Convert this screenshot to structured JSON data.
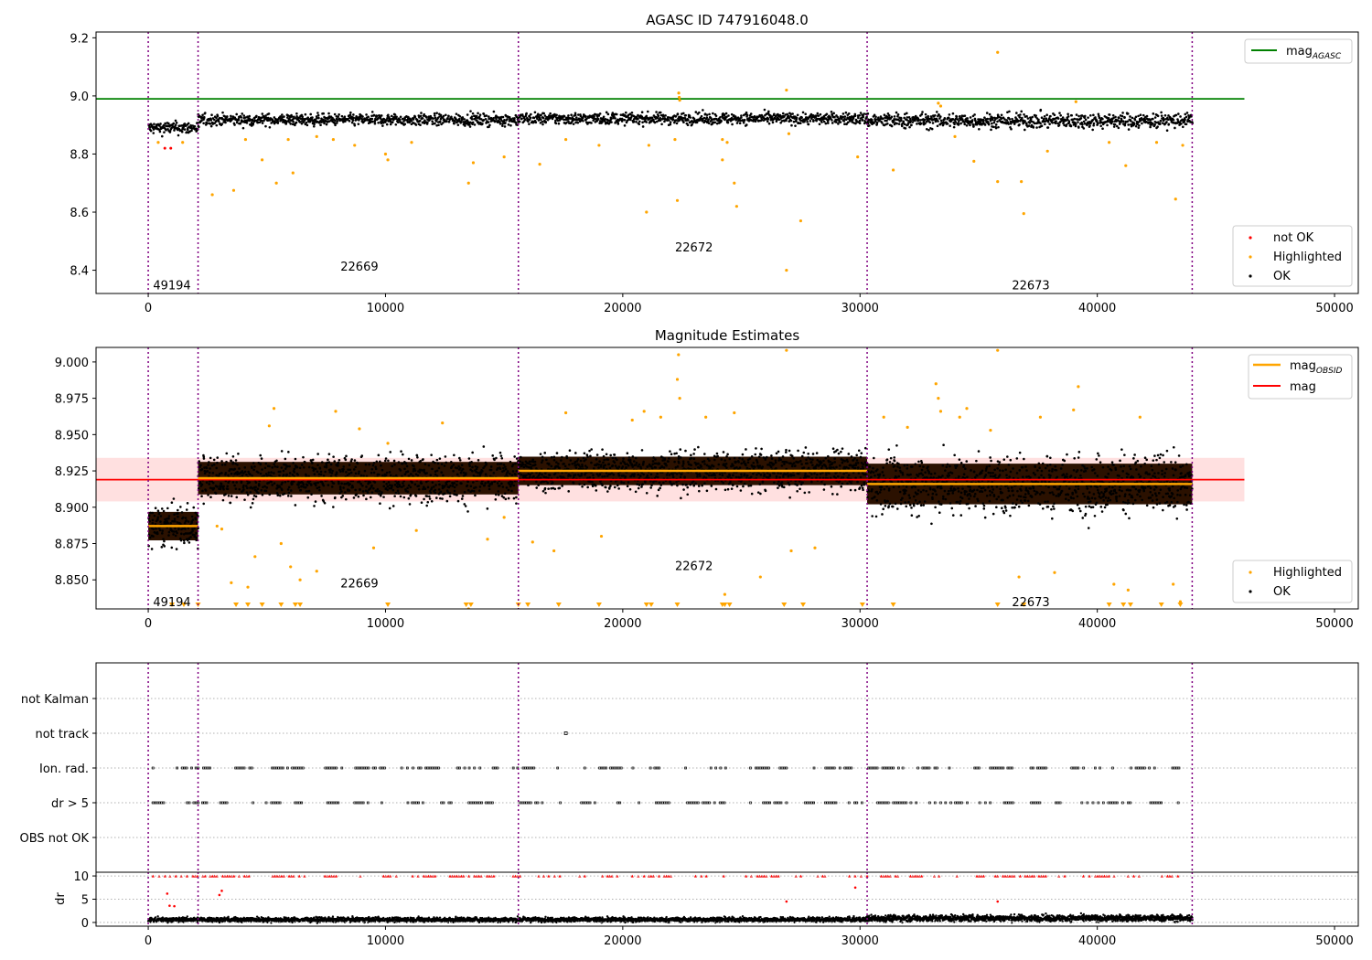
{
  "chart_data": [
    {
      "type": "scatter",
      "title": "AGASC ID 747916048.0",
      "xlim": [
        -2200,
        51000
      ],
      "ylim": [
        8.32,
        9.22
      ],
      "xticks": [
        0,
        10000,
        20000,
        30000,
        40000,
        50000
      ],
      "xtick_labels": [
        "0",
        "10000",
        "20000",
        "30000",
        "40000",
        "50000"
      ],
      "yticks": [
        8.4,
        8.6,
        8.8,
        9.0,
        9.2
      ],
      "ytick_labels": [
        "8.4",
        "8.6",
        "8.8",
        "9.0",
        "9.2"
      ],
      "obsid_boundaries": [
        0,
        2100,
        15600,
        30300,
        44000
      ],
      "obsid_labels": [
        {
          "text": "49194",
          "x": 1000,
          "y": 8.35
        },
        {
          "text": "22669",
          "x": 8900,
          "y": 8.415
        },
        {
          "text": "22672",
          "x": 23000,
          "y": 8.48
        },
        {
          "text": "22673",
          "x": 37200,
          "y": 8.35
        }
      ],
      "hline": {
        "name": "mag_AGASC",
        "y": 8.99,
        "x_range": [
          -2200,
          46200
        ],
        "color": "#008000"
      },
      "ok_band_segments": [
        {
          "x": [
            0,
            2100
          ],
          "center": 8.89,
          "spread": 0.022
        },
        {
          "x": [
            2100,
            15600
          ],
          "center": 8.918,
          "spread": 0.02
        },
        {
          "x": [
            15600,
            30300
          ],
          "center": 8.922,
          "spread": 0.02
        },
        {
          "x": [
            30300,
            44000
          ],
          "center": 8.915,
          "spread": 0.026
        }
      ],
      "highlighted_points": [
        [
          420,
          8.84
        ],
        [
          1450,
          8.84
        ],
        [
          2700,
          8.66
        ],
        [
          3600,
          8.675
        ],
        [
          4100,
          8.85
        ],
        [
          4800,
          8.78
        ],
        [
          5400,
          8.7
        ],
        [
          5900,
          8.85
        ],
        [
          6100,
          8.735
        ],
        [
          7100,
          8.86
        ],
        [
          7800,
          8.85
        ],
        [
          8700,
          8.83
        ],
        [
          10000,
          8.8
        ],
        [
          10100,
          8.78
        ],
        [
          11100,
          8.84
        ],
        [
          13500,
          8.7
        ],
        [
          13700,
          8.77
        ],
        [
          15000,
          8.79
        ],
        [
          16500,
          8.765
        ],
        [
          17600,
          8.85
        ],
        [
          19000,
          8.83
        ],
        [
          21000,
          8.6
        ],
        [
          21100,
          8.83
        ],
        [
          22200,
          8.85
        ],
        [
          22300,
          8.64
        ],
        [
          22360,
          9.01
        ],
        [
          22380,
          8.995
        ],
        [
          22400,
          8.985
        ],
        [
          24200,
          8.78
        ],
        [
          24200,
          8.85
        ],
        [
          24400,
          8.84
        ],
        [
          24700,
          8.7
        ],
        [
          24800,
          8.62
        ],
        [
          26900,
          8.4
        ],
        [
          26900,
          9.02
        ],
        [
          27000,
          8.87
        ],
        [
          27500,
          8.57
        ],
        [
          29900,
          8.79
        ],
        [
          31400,
          8.745
        ],
        [
          33300,
          8.975
        ],
        [
          33400,
          8.965
        ],
        [
          34000,
          8.86
        ],
        [
          34800,
          8.775
        ],
        [
          35800,
          8.705
        ],
        [
          35800,
          9.15
        ],
        [
          36800,
          8.705
        ],
        [
          36900,
          8.595
        ],
        [
          37900,
          8.81
        ],
        [
          39100,
          8.98
        ],
        [
          40500,
          8.84
        ],
        [
          41200,
          8.76
        ],
        [
          42500,
          8.84
        ],
        [
          43300,
          8.645
        ],
        [
          43600,
          8.83
        ]
      ],
      "notok_points": [
        [
          700,
          8.82
        ],
        [
          950,
          8.82
        ]
      ],
      "legends": [
        {
          "position": "top-right",
          "entries": [
            {
              "label": "mag",
              "sub": "AGASC",
              "kind": "line",
              "color": "#008000"
            }
          ]
        },
        {
          "position": "bottom-right",
          "entries": [
            {
              "label": "not OK",
              "kind": "dot",
              "color": "#ff0000"
            },
            {
              "label": "Highlighted",
              "kind": "dot",
              "color": "#ffa500"
            },
            {
              "label": "OK",
              "kind": "dot",
              "color": "#000000"
            }
          ]
        }
      ]
    },
    {
      "type": "scatter",
      "title": "Magnitude Estimates",
      "xlim": [
        -2200,
        51000
      ],
      "ylim": [
        8.83,
        9.01
      ],
      "xticks": [
        0,
        10000,
        20000,
        30000,
        40000,
        50000
      ],
      "xtick_labels": [
        "0",
        "10000",
        "20000",
        "30000",
        "40000",
        "50000"
      ],
      "yticks": [
        8.85,
        8.875,
        8.9,
        8.925,
        8.95,
        8.975,
        9.0
      ],
      "ytick_labels": [
        "8.850",
        "8.875",
        "8.900",
        "8.925",
        "8.950",
        "8.975",
        "9.000"
      ],
      "obsid_boundaries": [
        0,
        2100,
        15600,
        30300,
        44000
      ],
      "obsid_labels": [
        {
          "text": "49194",
          "x": 1000,
          "y": 8.835
        },
        {
          "text": "22669",
          "x": 8900,
          "y": 8.848
        },
        {
          "text": "22672",
          "x": 23000,
          "y": 8.86
        },
        {
          "text": "22673",
          "x": 37200,
          "y": 8.835
        }
      ],
      "mag": {
        "name": "mag",
        "y": 8.919,
        "band": [
          8.904,
          8.934
        ],
        "x_range": [
          -2200,
          46200
        ],
        "color": "#ff0000"
      },
      "mag_obsid": [
        {
          "x": [
            0,
            2100
          ],
          "y": 8.887
        },
        {
          "x": [
            2100,
            15600
          ],
          "y": 8.92
        },
        {
          "x": [
            15600,
            30300
          ],
          "y": 8.925
        },
        {
          "x": [
            30300,
            44000
          ],
          "y": 8.916
        }
      ],
      "ok_band_segments": [
        {
          "x": [
            0,
            2100
          ],
          "center": 8.887,
          "spread": 0.014
        },
        {
          "x": [
            2100,
            15600
          ],
          "center": 8.92,
          "spread": 0.016
        },
        {
          "x": [
            15600,
            30300
          ],
          "center": 8.925,
          "spread": 0.014
        },
        {
          "x": [
            30300,
            44000
          ],
          "center": 8.916,
          "spread": 0.02
        }
      ],
      "highlighted_points": [
        [
          2900,
          8.887
        ],
        [
          3100,
          8.885
        ],
        [
          3500,
          8.848
        ],
        [
          4200,
          8.845
        ],
        [
          4500,
          8.866
        ],
        [
          5100,
          8.956
        ],
        [
          5300,
          8.968
        ],
        [
          5600,
          8.875
        ],
        [
          6000,
          8.859
        ],
        [
          6400,
          8.85
        ],
        [
          7100,
          8.856
        ],
        [
          7900,
          8.966
        ],
        [
          8900,
          8.954
        ],
        [
          9500,
          8.872
        ],
        [
          10100,
          8.944
        ],
        [
          11300,
          8.884
        ],
        [
          12400,
          8.958
        ],
        [
          13500,
          8.83
        ],
        [
          14300,
          8.878
        ],
        [
          15000,
          8.893
        ],
        [
          16200,
          8.876
        ],
        [
          17100,
          8.87
        ],
        [
          17600,
          8.965
        ],
        [
          19100,
          8.88
        ],
        [
          20400,
          8.96
        ],
        [
          20900,
          8.966
        ],
        [
          21600,
          8.962
        ],
        [
          22300,
          8.988
        ],
        [
          22350,
          9.005
        ],
        [
          22400,
          8.975
        ],
        [
          23500,
          8.962
        ],
        [
          24300,
          8.84
        ],
        [
          24700,
          8.965
        ],
        [
          25800,
          8.852
        ],
        [
          26900,
          9.008
        ],
        [
          27100,
          8.87
        ],
        [
          28100,
          8.872
        ],
        [
          31000,
          8.962
        ],
        [
          32000,
          8.955
        ],
        [
          33200,
          8.985
        ],
        [
          33300,
          8.975
        ],
        [
          33400,
          8.966
        ],
        [
          34200,
          8.962
        ],
        [
          34500,
          8.968
        ],
        [
          35500,
          8.953
        ],
        [
          35800,
          9.008
        ],
        [
          36700,
          8.852
        ],
        [
          37600,
          8.962
        ],
        [
          38200,
          8.855
        ],
        [
          39200,
          8.983
        ],
        [
          39000,
          8.967
        ],
        [
          40700,
          8.847
        ],
        [
          41300,
          8.843
        ],
        [
          41800,
          8.962
        ],
        [
          43200,
          8.847
        ],
        [
          43500,
          8.835
        ]
      ],
      "clipped_x": [
        1000,
        1500,
        2100,
        3700,
        4200,
        4800,
        5600,
        6200,
        6400,
        10100,
        13400,
        13600,
        15600,
        16000,
        17300,
        19000,
        21000,
        21200,
        22300,
        24200,
        24300,
        24500,
        26800,
        27600,
        30100,
        31400,
        35800,
        36900,
        40500,
        41100,
        41400,
        42700,
        43500
      ],
      "legends": [
        {
          "position": "top-right",
          "entries": [
            {
              "label": "mag",
              "sub": "OBSID",
              "kind": "line",
              "color": "#ffa500"
            },
            {
              "label": "mag",
              "kind": "line",
              "color": "#ff0000"
            }
          ]
        },
        {
          "position": "bottom-right",
          "entries": [
            {
              "label": "Highlighted",
              "kind": "dot",
              "color": "#ffa500"
            },
            {
              "label": "OK",
              "kind": "dot",
              "color": "#000000"
            }
          ]
        }
      ]
    },
    {
      "type": "scatter",
      "xlim": [
        -2200,
        51000
      ],
      "categories": [
        "not Kalman",
        "not track",
        "Ion. rad.",
        "dr > 5",
        "OBS not OK"
      ],
      "obsid_boundaries": [
        0,
        2100,
        15600,
        30300,
        44000
      ],
      "flag_points": {
        "not track": [
          17600
        ],
        "Ion. rad.": "frequent",
        "dr > 5": "frequent"
      }
    },
    {
      "type": "scatter",
      "ylabel": "dr",
      "xlim": [
        -2200,
        51000
      ],
      "ylim": [
        -0.8,
        10.8
      ],
      "xticks": [
        0,
        10000,
        20000,
        30000,
        40000,
        50000
      ],
      "xtick_labels": [
        "0",
        "10000",
        "20000",
        "30000",
        "40000",
        "50000"
      ],
      "yticks": [
        0,
        5,
        10
      ],
      "ytick_labels": [
        "0",
        "5",
        "10"
      ],
      "obsid_boundaries": [
        0,
        2100,
        15600,
        30300,
        44000
      ],
      "red_points": [
        [
          800,
          6.2
        ],
        [
          900,
          3.6
        ],
        [
          1100,
          3.5
        ],
        [
          3000,
          5.9
        ],
        [
          3100,
          6.8
        ],
        [
          26900,
          4.5
        ],
        [
          29800,
          7.5
        ],
        [
          35800,
          4.5
        ]
      ],
      "ok_band_segments": [
        {
          "x": [
            0,
            30300
          ],
          "center": 0.6,
          "spread": 0.5
        },
        {
          "x": [
            30300,
            44000
          ],
          "center": 0.9,
          "spread": 0.7
        }
      ],
      "clip_value": 10
    }
  ]
}
